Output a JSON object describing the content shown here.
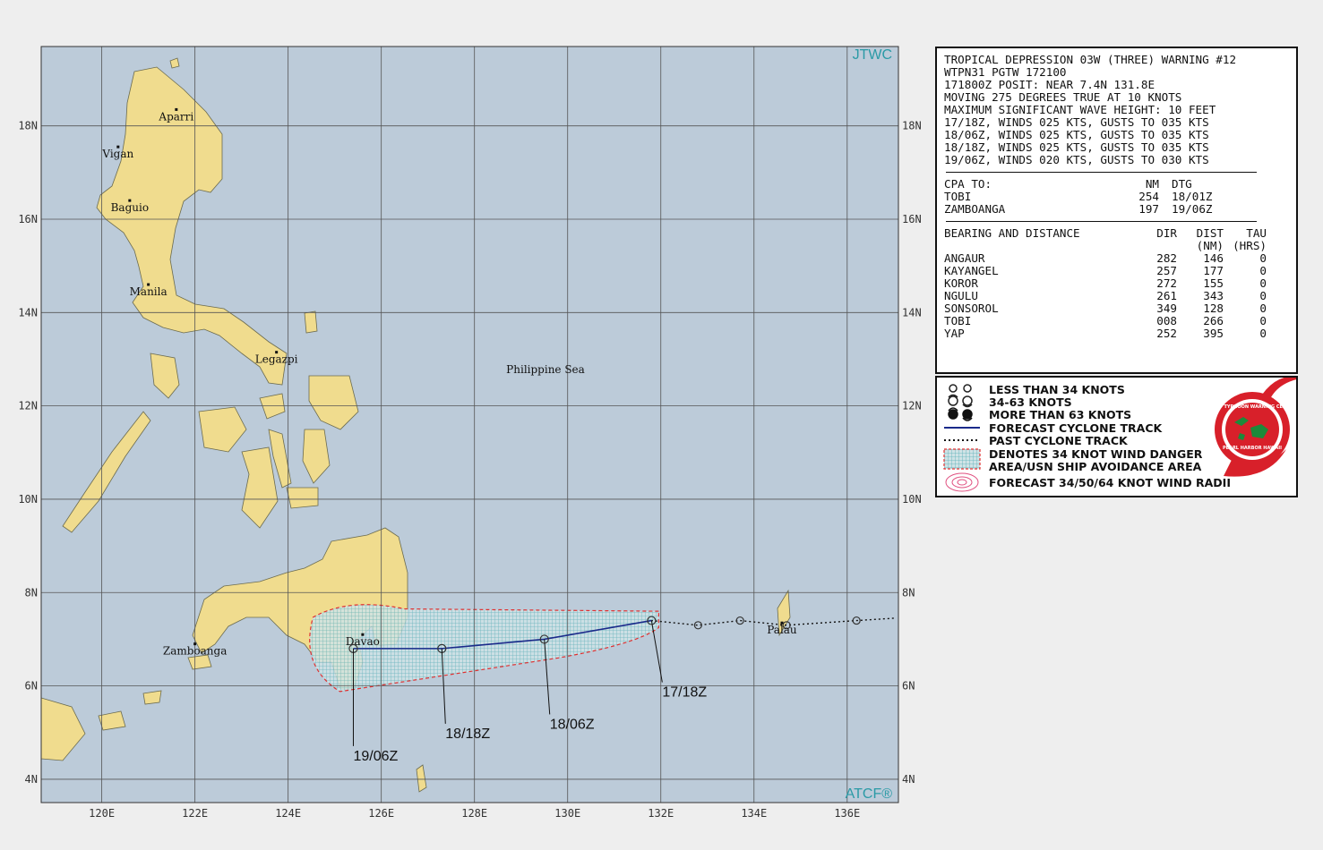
{
  "map": {
    "agency_top": "JTWC",
    "agency_bottom": "ATCF®",
    "lon_labels": [
      "120E",
      "122E",
      "124E",
      "126E",
      "128E",
      "130E",
      "132E",
      "134E",
      "136E"
    ],
    "lat_labels": [
      "18N",
      "16N",
      "14N",
      "12N",
      "10N",
      "8N",
      "6N",
      "4N"
    ],
    "places": [
      {
        "name": "Aparri",
        "lon": 121.6,
        "lat": 18.35
      },
      {
        "name": "Vigan",
        "lon": 120.35,
        "lat": 17.55
      },
      {
        "name": "Baguio",
        "lon": 120.6,
        "lat": 16.4
      },
      {
        "name": "Manila",
        "lon": 121.0,
        "lat": 14.6
      },
      {
        "name": "Legazpi",
        "lon": 123.75,
        "lat": 13.15
      },
      {
        "name": "Zamboanga",
        "lon": 122.0,
        "lat": 6.9
      },
      {
        "name": "Davao",
        "lon": 125.6,
        "lat": 7.1
      },
      {
        "name": "Palau",
        "lon": 134.6,
        "lat": 7.35
      }
    ],
    "sea_label": "Philippine Sea",
    "forecast_track": [
      {
        "lon": 131.8,
        "lat": 7.4,
        "label": "17/18Z"
      },
      {
        "lon": 129.5,
        "lat": 7.0,
        "label": "18/06Z"
      },
      {
        "lon": 127.3,
        "lat": 6.8,
        "label": "18/18Z"
      },
      {
        "lon": 125.4,
        "lat": 6.8,
        "label": "19/06Z"
      }
    ],
    "past_track": [
      {
        "lon": 137.0,
        "lat": 7.45
      },
      {
        "lon": 136.2,
        "lat": 7.4
      },
      {
        "lon": 134.7,
        "lat": 7.3
      },
      {
        "lon": 133.7,
        "lat": 7.4
      },
      {
        "lon": 132.8,
        "lat": 7.3
      },
      {
        "lon": 131.8,
        "lat": 7.4
      }
    ],
    "colors": {
      "sea": "#bccbd9",
      "land": "#f0dc8e",
      "grid": "#444444",
      "track": "#1a2a8a",
      "danger": "#e03030",
      "hatch": "#5ab0b8",
      "agency": "#2a9aa6"
    }
  },
  "info": {
    "lines": [
      "TROPICAL DEPRESSION 03W (THREE) WARNING #12",
      "WTPN31 PGTW 172100",
      "171800Z POSIT: NEAR 7.4N 131.8E",
      "MOVING 275 DEGREES TRUE AT 10 KNOTS",
      "MAXIMUM SIGNIFICANT WAVE HEIGHT: 10 FEET",
      "17/18Z, WINDS 025 KTS, GUSTS TO 035 KTS",
      "18/06Z, WINDS 025 KTS, GUSTS TO 035 KTS",
      "18/18Z, WINDS 025 KTS, GUSTS TO 035 KTS",
      "19/06Z, WINDS 020 KTS, GUSTS TO 030 KTS"
    ],
    "cpa_header": {
      "label": "CPA TO:",
      "nm": "NM",
      "dtg": "DTG"
    },
    "cpa": [
      {
        "name": "TOBI",
        "nm": "254",
        "dtg": "18/01Z"
      },
      {
        "name": "ZAMBOANGA",
        "nm": "197",
        "dtg": "19/06Z"
      }
    ],
    "bearing_header": {
      "label": "BEARING AND DISTANCE",
      "dir": "DIR",
      "dist": "DIST",
      "tau": "TAU",
      "dist_unit": "(NM)",
      "tau_unit": "(HRS)"
    },
    "bearings": [
      {
        "name": "ANGAUR",
        "dir": "282",
        "dist": "146",
        "tau": "0"
      },
      {
        "name": "KAYANGEL",
        "dir": "257",
        "dist": "177",
        "tau": "0"
      },
      {
        "name": "KOROR",
        "dir": "272",
        "dist": "155",
        "tau": "0"
      },
      {
        "name": "NGULU",
        "dir": "261",
        "dist": "343",
        "tau": "0"
      },
      {
        "name": "SONSOROL",
        "dir": "349",
        "dist": "128",
        "tau": "0"
      },
      {
        "name": "TOBI",
        "dir": "008",
        "dist": "266",
        "tau": "0"
      },
      {
        "name": "YAP",
        "dir": "252",
        "dist": "395",
        "tau": "0"
      }
    ]
  },
  "legend": {
    "less34": "LESS THAN 34 KNOTS",
    "k34_63": "34-63 KNOTS",
    "more63": "MORE THAN 63 KNOTS",
    "forecast": "FORECAST CYCLONE TRACK",
    "past": "PAST CYCLONE TRACK",
    "danger1": "DENOTES 34 KNOT WIND DANGER",
    "danger2": "AREA/USN SHIP AVOIDANCE AREA",
    "radii": "FORECAST 34/50/64 KNOT WIND RADII",
    "logo_text": "JOINT TYPHOON WARNING CENTER",
    "logo_sub": "PEARL HARBOR HAWAII"
  }
}
